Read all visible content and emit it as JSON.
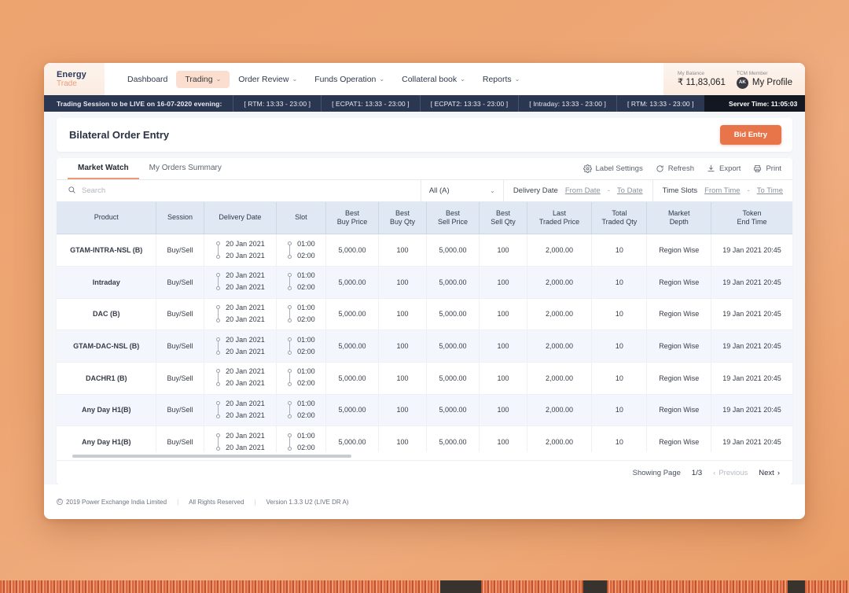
{
  "brand": {
    "line1": "Energy",
    "line2": "Trade"
  },
  "nav": {
    "items": [
      {
        "label": "Dashboard",
        "has_caret": false,
        "active": false
      },
      {
        "label": "Trading",
        "has_caret": true,
        "active": true
      },
      {
        "label": "Order Review",
        "has_caret": true,
        "active": false
      },
      {
        "label": "Funds Operation",
        "has_caret": true,
        "active": false
      },
      {
        "label": "Collateral book",
        "has_caret": true,
        "active": false
      },
      {
        "label": "Reports",
        "has_caret": true,
        "active": false
      }
    ],
    "balance_label": "My Balance",
    "balance_value": "₹ 11,83,061",
    "member_label": "TCM Member",
    "avatar_initials": "AK",
    "profile_label": "My Profile"
  },
  "banner": {
    "message": "Trading Session to be LIVE on 16-07-2020 evening:",
    "sessions": [
      "[ RTM:  13:33 - 23:00 ]",
      "[ ECPAT1:  13:33 - 23:00 ]",
      "[ ECPAT2:  13:33 - 23:00 ]",
      "[ Intraday:  13:33 - 23:00 ]",
      "[ RTM:  13:33 - 23:00 ]"
    ],
    "server_time_label": "Server Time:",
    "server_time_value": "11:05:03"
  },
  "page": {
    "title": "Bilateral Order Entry",
    "bid_entry_label": "Bid Entry"
  },
  "tabs": [
    {
      "label": "Market Watch",
      "active": true
    },
    {
      "label": "My Orders Summary",
      "active": false
    }
  ],
  "tools": [
    {
      "label": "Label Settings",
      "icon": "gear-icon"
    },
    {
      "label": "Refresh",
      "icon": "refresh-icon"
    },
    {
      "label": "Export",
      "icon": "download-icon"
    },
    {
      "label": "Print",
      "icon": "printer-icon"
    }
  ],
  "filters": {
    "search_placeholder": "Search",
    "select_value": "All (A)",
    "delivery_date_label": "Delivery Date",
    "from_date_label": "From Date",
    "to_date_label": "To Date",
    "dash": "-",
    "time_slots_label": "Time Slots",
    "from_time_label": "From Time",
    "to_time_label": "To Time"
  },
  "table": {
    "columns": [
      {
        "l1": "Product",
        "l2": ""
      },
      {
        "l1": "Session",
        "l2": ""
      },
      {
        "l1": "Delivery Date",
        "l2": ""
      },
      {
        "l1": "Slot",
        "l2": ""
      },
      {
        "l1": "Best",
        "l2": "Buy Price"
      },
      {
        "l1": "Best",
        "l2": "Buy Qty"
      },
      {
        "l1": "Best",
        "l2": "Sell Price"
      },
      {
        "l1": "Best",
        "l2": "Sell Qty"
      },
      {
        "l1": "Last",
        "l2": "Traded Price"
      },
      {
        "l1": "Total",
        "l2": "Traded Qty"
      },
      {
        "l1": "Market",
        "l2": "Depth"
      },
      {
        "l1": "Token",
        "l2": "End Time"
      }
    ],
    "rows": [
      {
        "product": "GTAM-INTRA-NSL (B)",
        "session": "Buy/Sell",
        "date_from": "20 Jan 2021",
        "date_to": "20 Jan 2021",
        "slot_from": "01:00",
        "slot_to": "02:00",
        "best_buy_price": "5,000.00",
        "best_buy_qty": "100",
        "best_sell_price": "5,000.00",
        "best_sell_qty": "100",
        "last_traded_price": "2,000.00",
        "total_traded_qty": "10",
        "market_depth": "Region Wise",
        "token_end_time": "19 Jan 2021 20:45"
      },
      {
        "product": "Intraday",
        "session": "Buy/Sell",
        "date_from": "20 Jan 2021",
        "date_to": "20 Jan 2021",
        "slot_from": "01:00",
        "slot_to": "02:00",
        "best_buy_price": "5,000.00",
        "best_buy_qty": "100",
        "best_sell_price": "5,000.00",
        "best_sell_qty": "100",
        "last_traded_price": "2,000.00",
        "total_traded_qty": "10",
        "market_depth": "Region Wise",
        "token_end_time": "19 Jan 2021 20:45"
      },
      {
        "product": "DAC (B)",
        "session": "Buy/Sell",
        "date_from": "20 Jan 2021",
        "date_to": "20 Jan 2021",
        "slot_from": "01:00",
        "slot_to": "02:00",
        "best_buy_price": "5,000.00",
        "best_buy_qty": "100",
        "best_sell_price": "5,000.00",
        "best_sell_qty": "100",
        "last_traded_price": "2,000.00",
        "total_traded_qty": "10",
        "market_depth": "Region Wise",
        "token_end_time": "19 Jan 2021 20:45"
      },
      {
        "product": "GTAM-DAC-NSL (B)",
        "session": "Buy/Sell",
        "date_from": "20 Jan 2021",
        "date_to": "20 Jan 2021",
        "slot_from": "01:00",
        "slot_to": "02:00",
        "best_buy_price": "5,000.00",
        "best_buy_qty": "100",
        "best_sell_price": "5,000.00",
        "best_sell_qty": "100",
        "last_traded_price": "2,000.00",
        "total_traded_qty": "10",
        "market_depth": "Region Wise",
        "token_end_time": "19 Jan 2021 20:45"
      },
      {
        "product": "DACHR1 (B)",
        "session": "Buy/Sell",
        "date_from": "20 Jan 2021",
        "date_to": "20 Jan 2021",
        "slot_from": "01:00",
        "slot_to": "02:00",
        "best_buy_price": "5,000.00",
        "best_buy_qty": "100",
        "best_sell_price": "5,000.00",
        "best_sell_qty": "100",
        "last_traded_price": "2,000.00",
        "total_traded_qty": "10",
        "market_depth": "Region Wise",
        "token_end_time": "19 Jan 2021 20:45"
      },
      {
        "product": "Any Day H1(B)",
        "session": "Buy/Sell",
        "date_from": "20 Jan 2021",
        "date_to": "20 Jan 2021",
        "slot_from": "01:00",
        "slot_to": "02:00",
        "best_buy_price": "5,000.00",
        "best_buy_qty": "100",
        "best_sell_price": "5,000.00",
        "best_sell_qty": "100",
        "last_traded_price": "2,000.00",
        "total_traded_qty": "10",
        "market_depth": "Region Wise",
        "token_end_time": "19 Jan 2021 20:45"
      },
      {
        "product": "Any Day H1(B)",
        "session": "Buy/Sell",
        "date_from": "20 Jan 2021",
        "date_to": "20 Jan 2021",
        "slot_from": "01:00",
        "slot_to": "02:00",
        "best_buy_price": "5,000.00",
        "best_buy_qty": "100",
        "best_sell_price": "5,000.00",
        "best_sell_qty": "100",
        "last_traded_price": "2,000.00",
        "total_traded_qty": "10",
        "market_depth": "Region Wise",
        "token_end_time": "19 Jan 2021 20:45"
      }
    ]
  },
  "pagination": {
    "showing_label": "Showing Page",
    "page_value": "1/3",
    "previous_label": "Previous",
    "next_label": "Next"
  },
  "footer": {
    "copyright": "2019 Power Exchange India Limited",
    "rights": "All Rights Reserved",
    "version": "Version 1.3.3 U2 (LIVE DR A)"
  },
  "colors": {
    "accent": "#e8754a",
    "nav_active_bg": "#fbded0",
    "banner_bg": "#2b3650",
    "server_time_bg": "#121722",
    "table_header_bg": "#dfe8f3",
    "row_stripe": "#f3f7fd",
    "page_bg": "#eda573"
  }
}
